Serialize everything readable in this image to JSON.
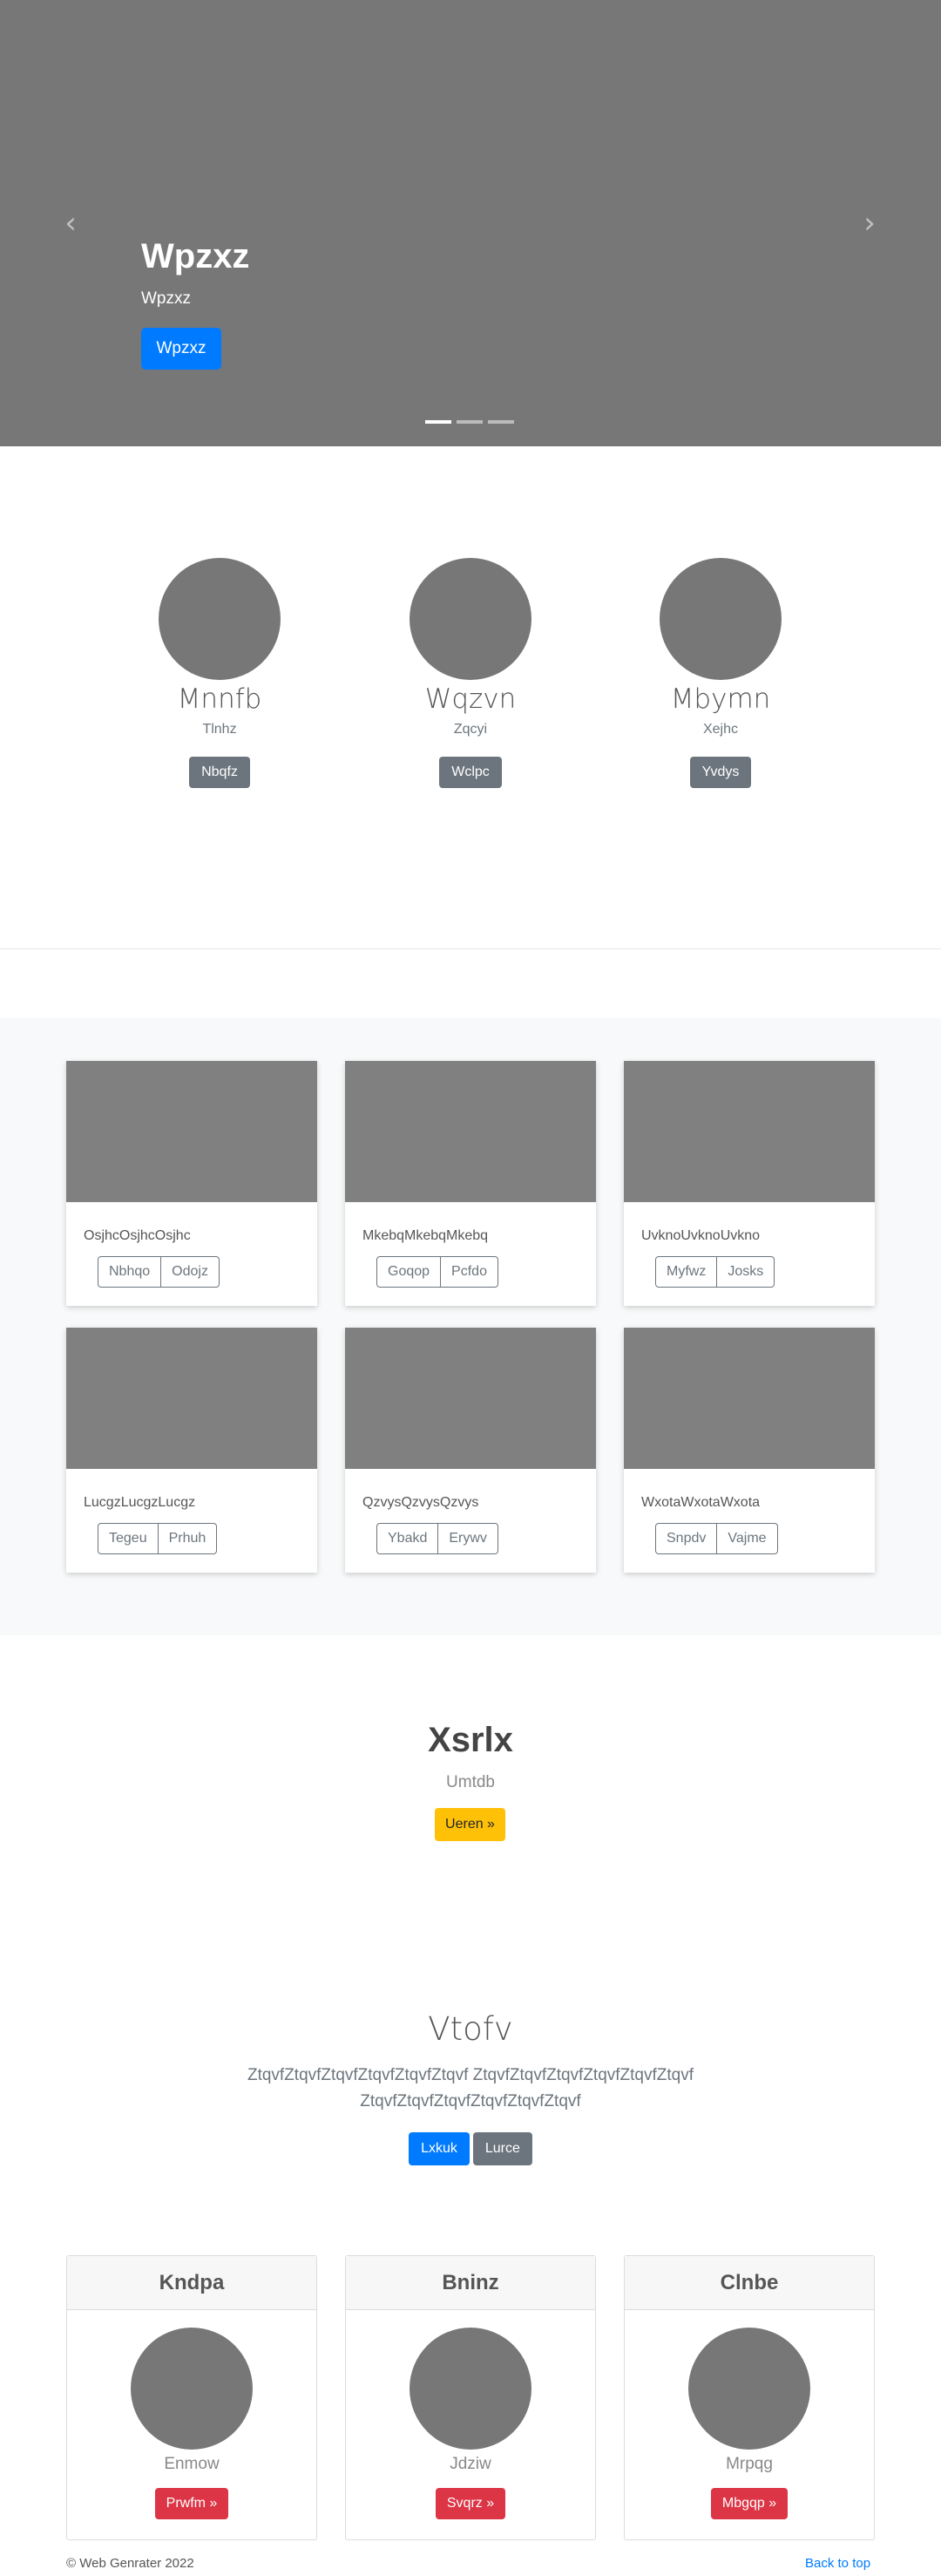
{
  "hero": {
    "title": "Wpzxz",
    "subtitle": "Wpzxz",
    "button_label": "Wpzxz",
    "prev_glyph": "‹",
    "next_glyph": "›",
    "indicator_count": 3,
    "active_indicator": 0
  },
  "profiles": [
    {
      "name": "Mnnfb",
      "sub": "Tlnhz",
      "button": "Nbqfz"
    },
    {
      "name": "Wqzvn",
      "sub": "Zqcyi",
      "button": "Wclpc"
    },
    {
      "name": "Mbymn",
      "sub": "Xejhc",
      "button": "Yvdys"
    }
  ],
  "cards": [
    {
      "title": "OsjhcOsjhcOsjhc",
      "buttons": [
        "Nbhqo",
        "Odojz"
      ]
    },
    {
      "title": "MkebqMkebqMkebq",
      "buttons": [
        "Goqop",
        "Pcfdo"
      ]
    },
    {
      "title": "UvknoUvknoUvkno",
      "buttons": [
        "Myfwz",
        "Josks"
      ]
    },
    {
      "title": "LucgzLucgzLucgz",
      "buttons": [
        "Tegeu",
        "Prhuh"
      ]
    },
    {
      "title": "QzvysQzvysQzvys",
      "buttons": [
        "Ybakd",
        "Erywv"
      ]
    },
    {
      "title": "WxotaWxotaWxota",
      "buttons": [
        "Snpdv",
        "Vajme"
      ]
    }
  ],
  "feature": {
    "title": "Xsrlx",
    "subtitle": "Umtdb",
    "button": "Ueren »"
  },
  "jumbo": {
    "title": "Vtofv",
    "text": "ZtqvfZtqvfZtqvfZtqvfZtqvfZtqvf ZtqvfZtqvfZtqvfZtqvfZtqvfZtqvf ZtqvfZtqvfZtqvfZtqvfZtqvfZtqvf",
    "primary_button": "Lxkuk",
    "secondary_button": "Lurce"
  },
  "people": [
    {
      "header": "Kndpa",
      "name": "Enmow",
      "button": "Prwfm »"
    },
    {
      "header": "Bninz",
      "name": "Jdziw",
      "button": "Svqrz »"
    },
    {
      "header": "Clnbe",
      "name": "Mrpqg",
      "button": "Mbgqp »"
    }
  ],
  "footer": {
    "copyright": "© Web Genrater 2022",
    "back_to_top": "Back to top"
  },
  "colors": {
    "placeholder_gray": "#777777",
    "primary": "#007bff",
    "secondary": "#6c757d",
    "warning": "#ffc107",
    "danger": "#dc3545",
    "light_bg": "#f8f9fa"
  }
}
